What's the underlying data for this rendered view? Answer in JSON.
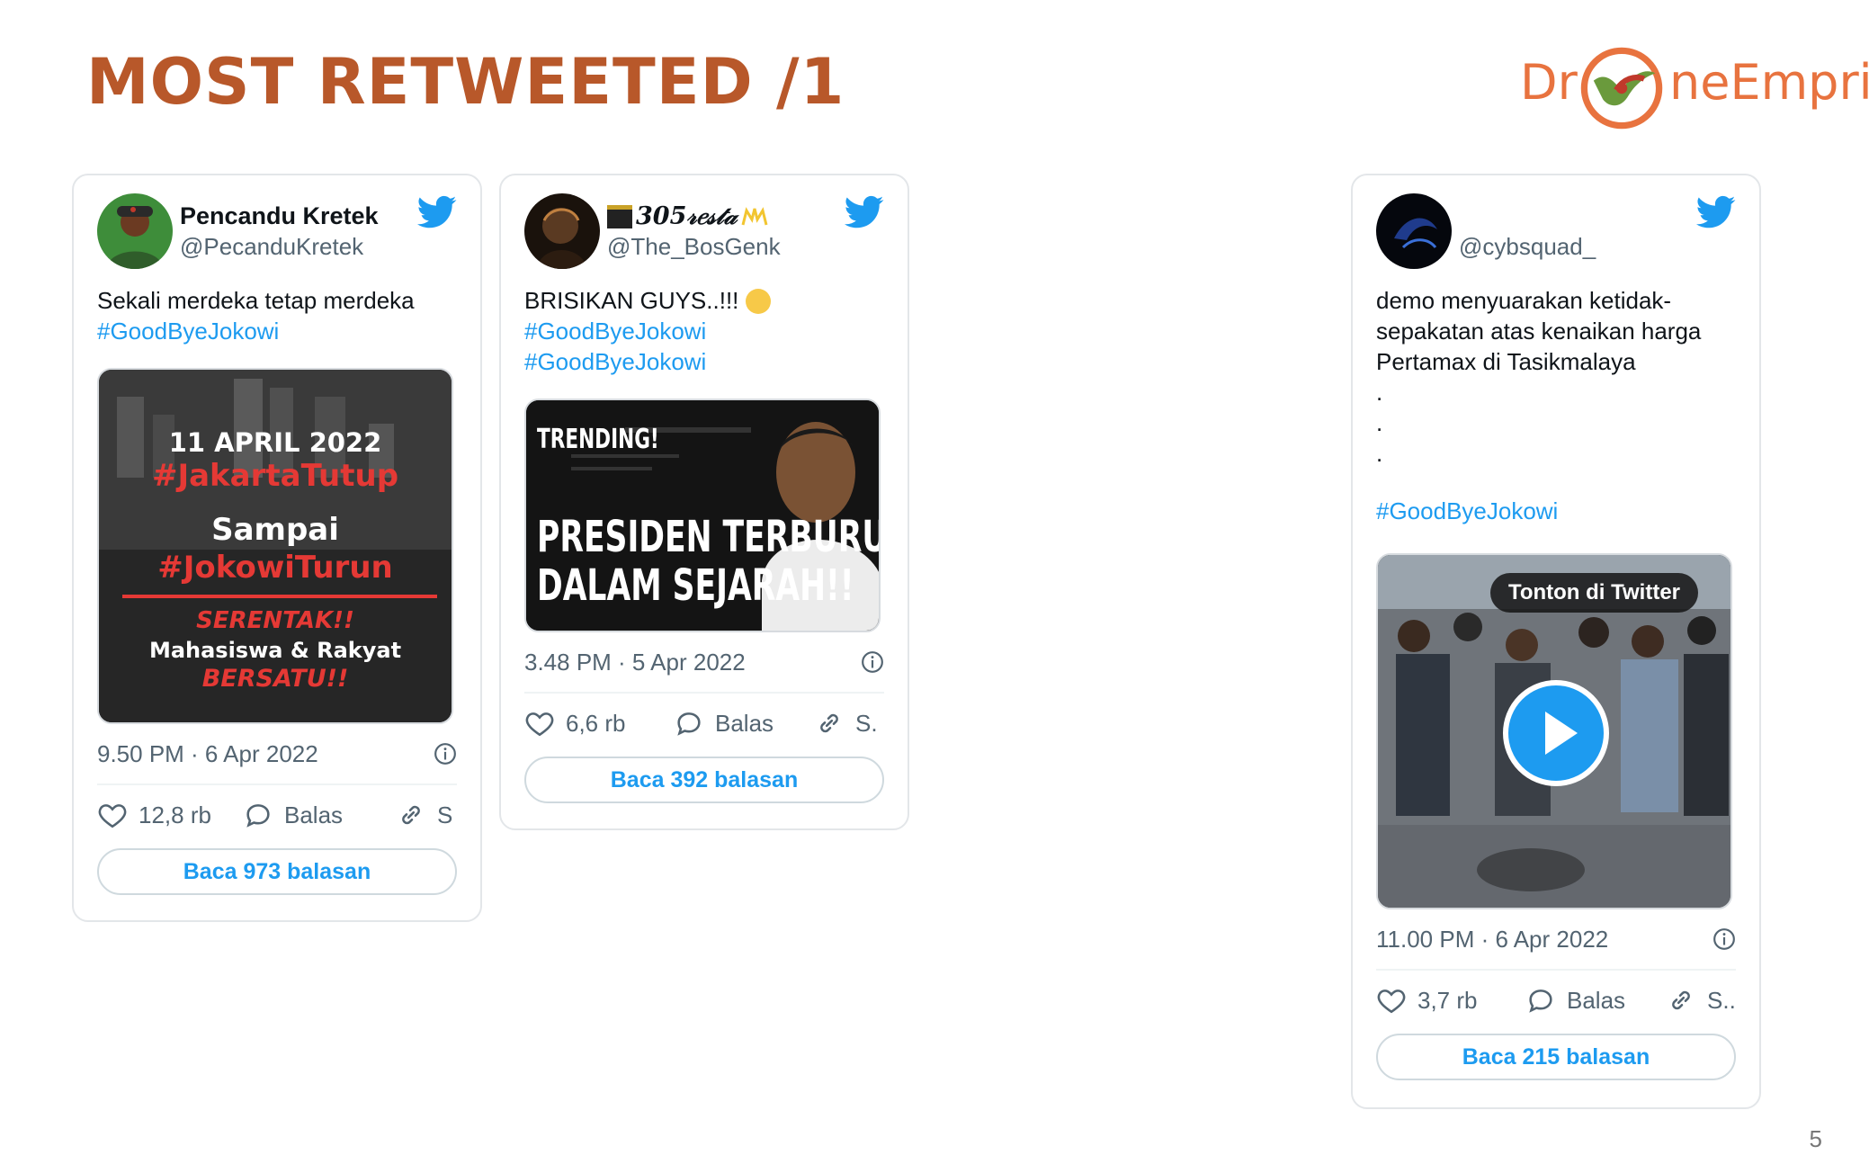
{
  "slide": {
    "title": "MOST RETWEETED /1",
    "page_number": "5",
    "logo": {
      "left": "Dr",
      "right": "neEmprit"
    }
  },
  "tweets": [
    {
      "name": "Pencandu Kretek",
      "handle": "@PecanduKretek",
      "text_lines": [
        "Sekali merdeka tetap merdeka"
      ],
      "hashtags": [
        "#GoodByeJokowi"
      ],
      "media": {
        "type": "image",
        "lines": [
          "11 APRIL 2022",
          "#JakartaTutup",
          "Sampai",
          "#JokowiTurun",
          "SERENTAK!!",
          "Mahasiswa & Rakyat",
          "BERSATU!!"
        ]
      },
      "timestamp": "9.50 PM · 6 Apr 2022",
      "likes": "12,8 rb",
      "reply_label": "Balas",
      "share_label": "S",
      "read_replies": "Baca 973 balasan"
    },
    {
      "name": "305𝓇𝑒𝓈𝓉𝒶",
      "handle": "@The_BosGenk",
      "text_lines": [
        "BRISIKAN GUYS..!!!"
      ],
      "hashtags": [
        "#GoodByeJokowi",
        "#GoodByeJokowi"
      ],
      "media": {
        "type": "image",
        "lines": [
          "TRENDING!",
          "PRESIDEN TERBURUK",
          "DALAM SEJARAH!!"
        ]
      },
      "timestamp": "3.48 PM · 5 Apr 2022",
      "likes": "6,6 rb",
      "reply_label": "Balas",
      "share_label": "S.",
      "read_replies": "Baca 392 balasan"
    },
    {
      "name": "",
      "handle": "@cybsquad_",
      "text_lines": [
        "demo menyuarakan ketidak-",
        "sepakatan atas kenaikan harga",
        "Pertamax di Tasikmalaya",
        ".",
        ".",
        "."
      ],
      "hashtags": [
        "#GoodByeJokowi"
      ],
      "media": {
        "type": "video",
        "overlay": "Tonton di Twitter"
      },
      "timestamp": "11.00 PM · 6 Apr 2022",
      "likes": "3,7 rb",
      "reply_label": "Balas",
      "share_label": "S..",
      "read_replies": "Baca 215 balasan"
    }
  ],
  "colors": {
    "title": "#b8582a",
    "logo": "#e8733f",
    "twitter_blue": "#1d9bf0",
    "muted": "#536471"
  },
  "icons": [
    "twitter-bird-icon",
    "heart-icon",
    "comment-icon",
    "link-icon",
    "info-icon",
    "play-icon",
    "kaaba-emoji-icon",
    "fist-emoji-icon"
  ]
}
